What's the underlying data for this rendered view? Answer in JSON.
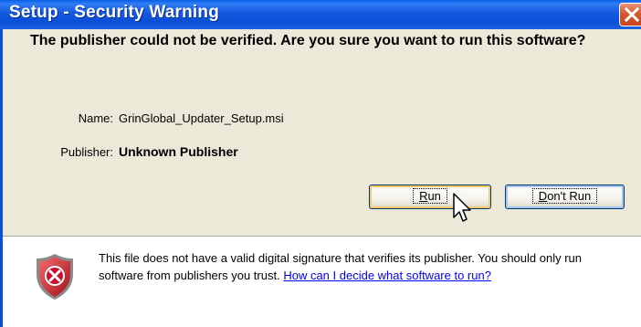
{
  "window": {
    "title": "Setup - Security Warning"
  },
  "question": "The publisher could not be verified.  Are you sure you want to run this software?",
  "fields": {
    "name_label": "Name:",
    "name_value": "GrinGlobal_Updater_Setup.msi",
    "publisher_label": "Publisher:",
    "publisher_value": "Unknown Publisher"
  },
  "buttons": {
    "run_prefix": "",
    "run_mnemonic": "R",
    "run_suffix": "un",
    "dont_prefix": "",
    "dont_mnemonic": "D",
    "dont_suffix": "on't Run"
  },
  "warning": {
    "text": "This file does not have a valid digital signature that verifies its publisher. You should only run software from publishers you trust.",
    "link": "How can I decide what software to run?"
  },
  "icons": {
    "close": "close-icon",
    "shield": "shield-error-icon",
    "cursor": "mouse-pointer-icon"
  },
  "colors": {
    "titlebar": "#0b4fd6",
    "close_button": "#d6582f",
    "link": "#0000ff",
    "dialog_bg": "#ece9d8",
    "shield_red": "#c8102e"
  }
}
